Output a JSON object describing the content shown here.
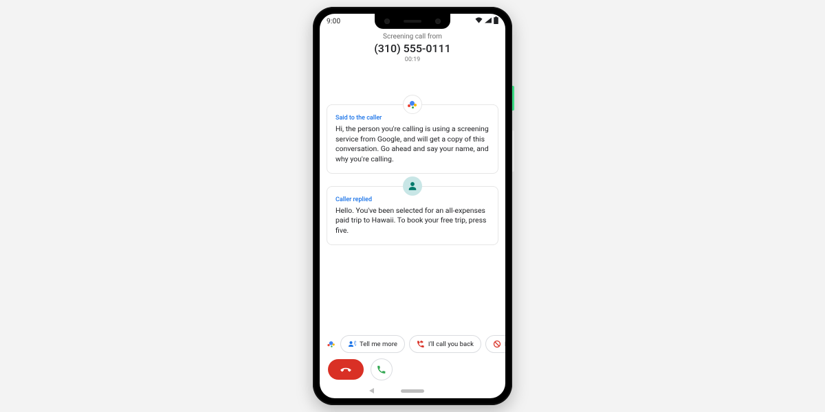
{
  "status": {
    "time": "9:00"
  },
  "header": {
    "screening_label": "Screening call from",
    "phone_number": "(310) 555-0111",
    "duration": "00:19"
  },
  "transcript": {
    "assistant": {
      "label": "Said to the caller",
      "body": "Hi, the person you're calling is using a screening service from Google, and will get a copy of this conversation. Go ahead and say your name, and why you're calling."
    },
    "caller": {
      "label": "Caller replied",
      "body": "Hello. You've been selected for an all-expenses paid trip to Hawaii. To book your free trip, press five."
    }
  },
  "chips": {
    "tell_more": "Tell me more",
    "call_back": "I'll call you back",
    "report_partial": "R"
  }
}
